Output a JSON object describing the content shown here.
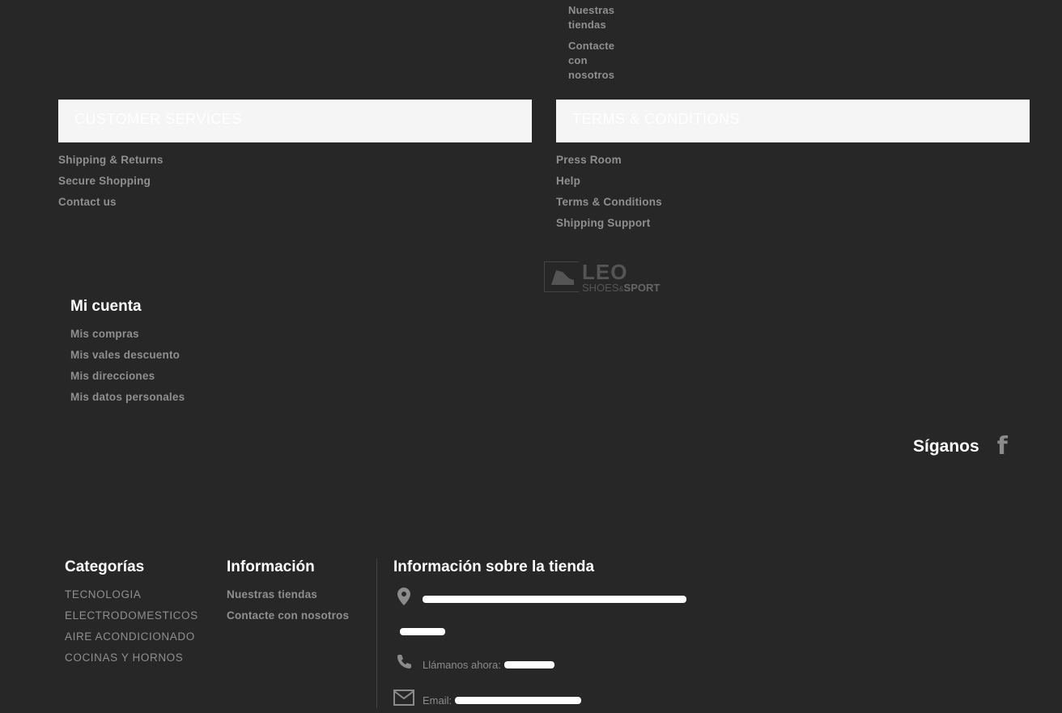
{
  "top_links": [
    "Nuestras tiendas",
    "Contacte con nosotros"
  ],
  "customer_services": {
    "title": "Customer Services",
    "links": [
      "Shipping & Returns",
      "Secure Shopping",
      "Contact us"
    ]
  },
  "terms": {
    "title": "Terms & Conditions",
    "links": [
      "Press Room",
      "Help",
      "Terms & Conditions",
      "Shipping Support"
    ]
  },
  "logo": {
    "main": "LEO",
    "sub_a": "SHOES",
    "sub_amp": "&",
    "sub_b": "SPORT"
  },
  "account": {
    "title": "Mi cuenta",
    "links": [
      "Mis compras",
      "Mis vales descuento",
      "Mis direcciones",
      "Mis datos personales"
    ]
  },
  "follow": {
    "title": "Síganos",
    "icon": "facebook-icon"
  },
  "categories": {
    "title": "Categorías",
    "links": [
      "TECNOLOGIA",
      "ELECTRODOMESTICOS",
      "AIRE ACONDICIONADO",
      "COCINAS Y HORNOS"
    ]
  },
  "information": {
    "title": "Información",
    "links": [
      "Nuestras tiendas",
      "Contacte con nosotros"
    ]
  },
  "store_info": {
    "title": "Información sobre la tienda",
    "call_label": "Llámanos ahora:",
    "email_label": "Email:",
    "icons": [
      "map-marker-icon",
      "phone-icon",
      "envelope-icon"
    ]
  }
}
